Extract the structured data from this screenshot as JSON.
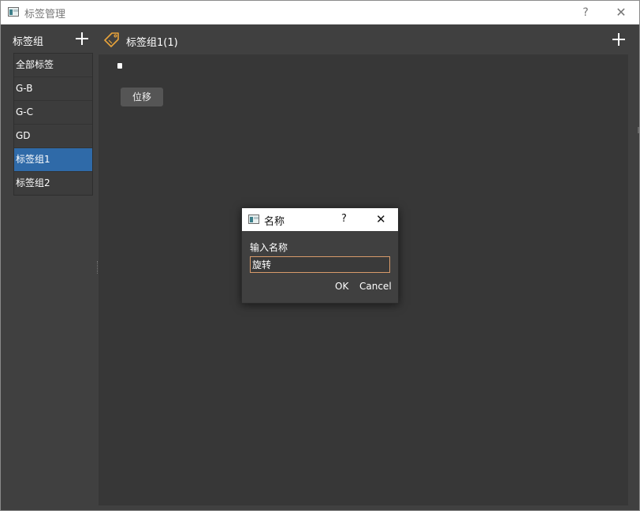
{
  "window": {
    "title": "标签管理",
    "help_glyph": "?",
    "close_glyph": "✕"
  },
  "sidebar": {
    "title": "标签组",
    "add_icon": "plus-icon",
    "items": [
      {
        "label": "全部标签"
      },
      {
        "label": "G-B"
      },
      {
        "label": "G-C"
      },
      {
        "label": "GD"
      },
      {
        "label": "标签组1",
        "selected": true
      },
      {
        "label": "标签组2"
      }
    ]
  },
  "main": {
    "icon": "tag-icon",
    "title": "标签组1(1)",
    "tags": [
      {
        "label": "位移"
      }
    ]
  },
  "dialog": {
    "title": "名称",
    "help_glyph": "?",
    "close_glyph": "✕",
    "label": "输入名称",
    "input_value": "旋转",
    "ok_label": "OK",
    "cancel_label": "Cancel"
  },
  "colors": {
    "selected": "#2f6aa8",
    "background": "#404040",
    "canvas": "#373737",
    "tag_icon": "#e8a33a",
    "input_border": "#d89a6a"
  }
}
